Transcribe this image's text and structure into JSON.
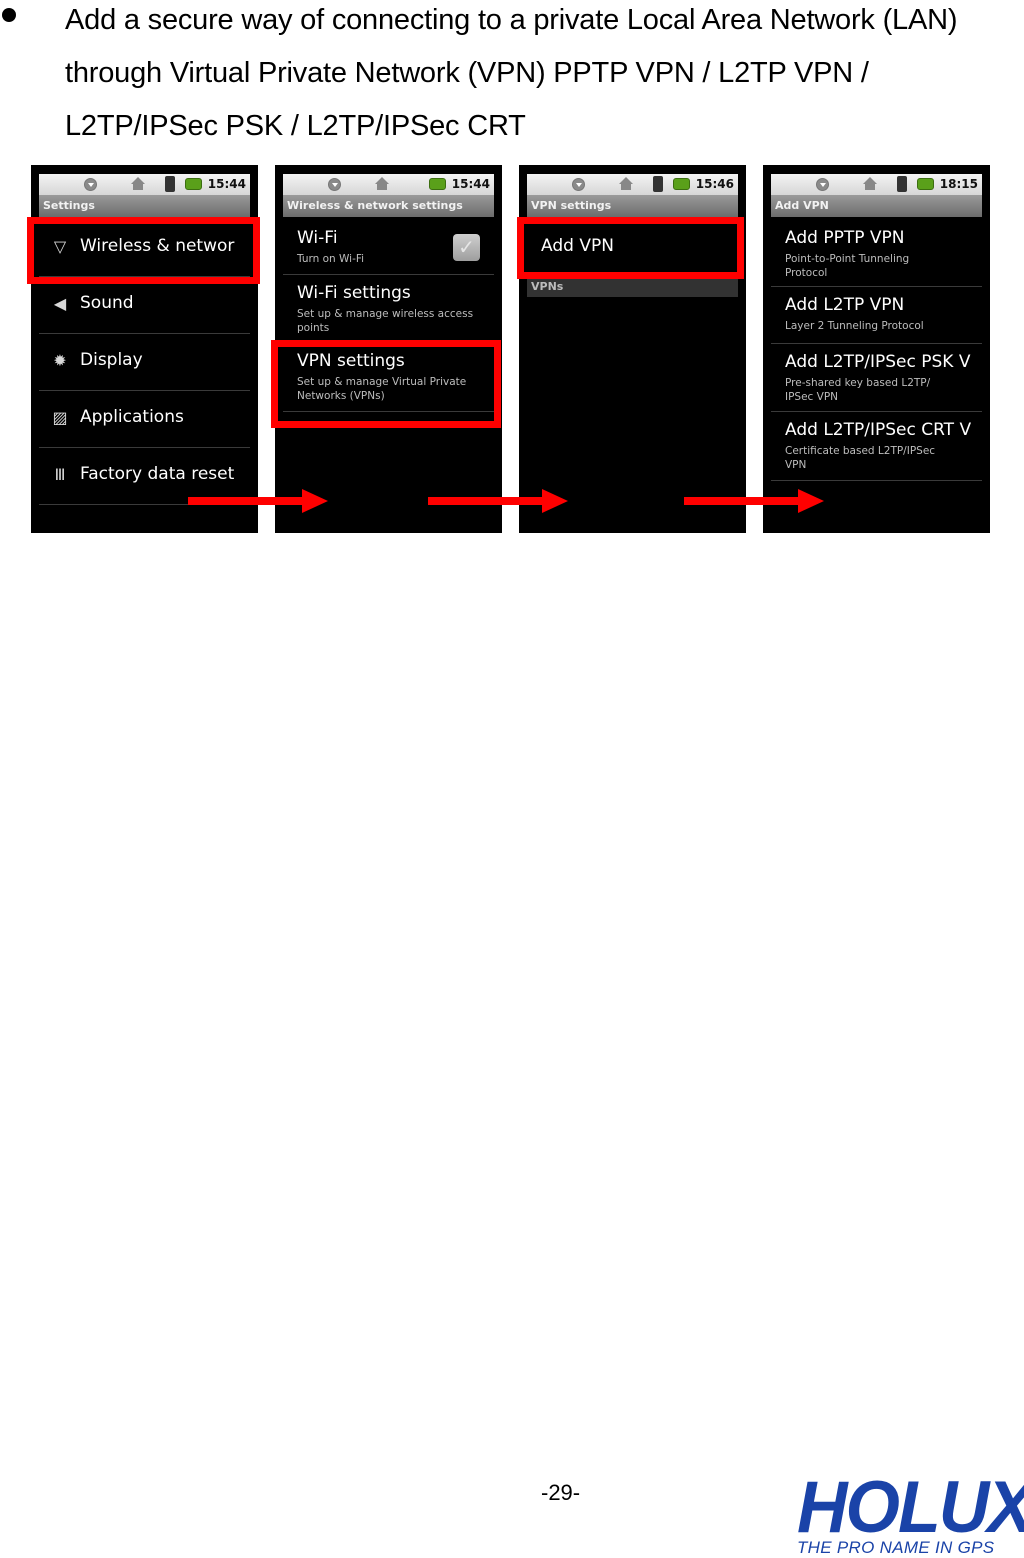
{
  "bullet": {
    "text": "Add a secure way of connecting to a private Local Area Network (LAN) through Virtual Private Network (VPN) PPTP VPN / L2TP VPN / L2TP/IPSec PSK / L2TP/IPSec CRT"
  },
  "screens": [
    {
      "time": "15:44",
      "title": "Settings",
      "items": [
        {
          "label": "Wireless & networ",
          "icon": "wifi-icon"
        },
        {
          "label": "Sound",
          "icon": "speaker-icon"
        },
        {
          "label": "Display",
          "icon": "brightness-icon"
        },
        {
          "label": "Applications",
          "icon": "applications-icon"
        },
        {
          "label": "Factory data reset",
          "icon": "reset-icon"
        }
      ],
      "highlighted": "Wireless & networ"
    },
    {
      "time": "15:44",
      "title": "Wireless & network settings",
      "items": [
        {
          "label": "Wi-Fi",
          "sub": "Turn on Wi-Fi",
          "checked": true
        },
        {
          "label": "Wi-Fi settings",
          "sub": "Set up & manage wireless access points"
        },
        {
          "label": "VPN settings",
          "sub": "Set up & manage Virtual Private Networks (VPNs)"
        }
      ],
      "highlighted": "VPN settings"
    },
    {
      "time": "15:46",
      "title": "VPN settings",
      "items": [
        {
          "label": "Add VPN"
        }
      ],
      "section_header": "VPNs",
      "highlighted": "Add VPN"
    },
    {
      "time": "18:15",
      "title": "Add VPN",
      "items": [
        {
          "label": "Add PPTP VPN",
          "sub": "Point-to-Point Tunneling Protocol"
        },
        {
          "label": "Add L2TP VPN",
          "sub": "Layer 2 Tunneling Protocol"
        },
        {
          "label": "Add L2TP/IPSec PSK V",
          "sub": "Pre-shared key based L2TP/ IPSec VPN"
        },
        {
          "label": "Add L2TP/IPSec CRT V",
          "sub": "Certificate based L2TP/IPSec VPN"
        }
      ]
    }
  ],
  "colors": {
    "highlight": "#ff0000",
    "logo": "#1a43a8"
  },
  "footer": {
    "page_number": "-29-",
    "logo_text": "HOLUX",
    "logo_tagline": "THE PRO NAME IN GPS"
  }
}
